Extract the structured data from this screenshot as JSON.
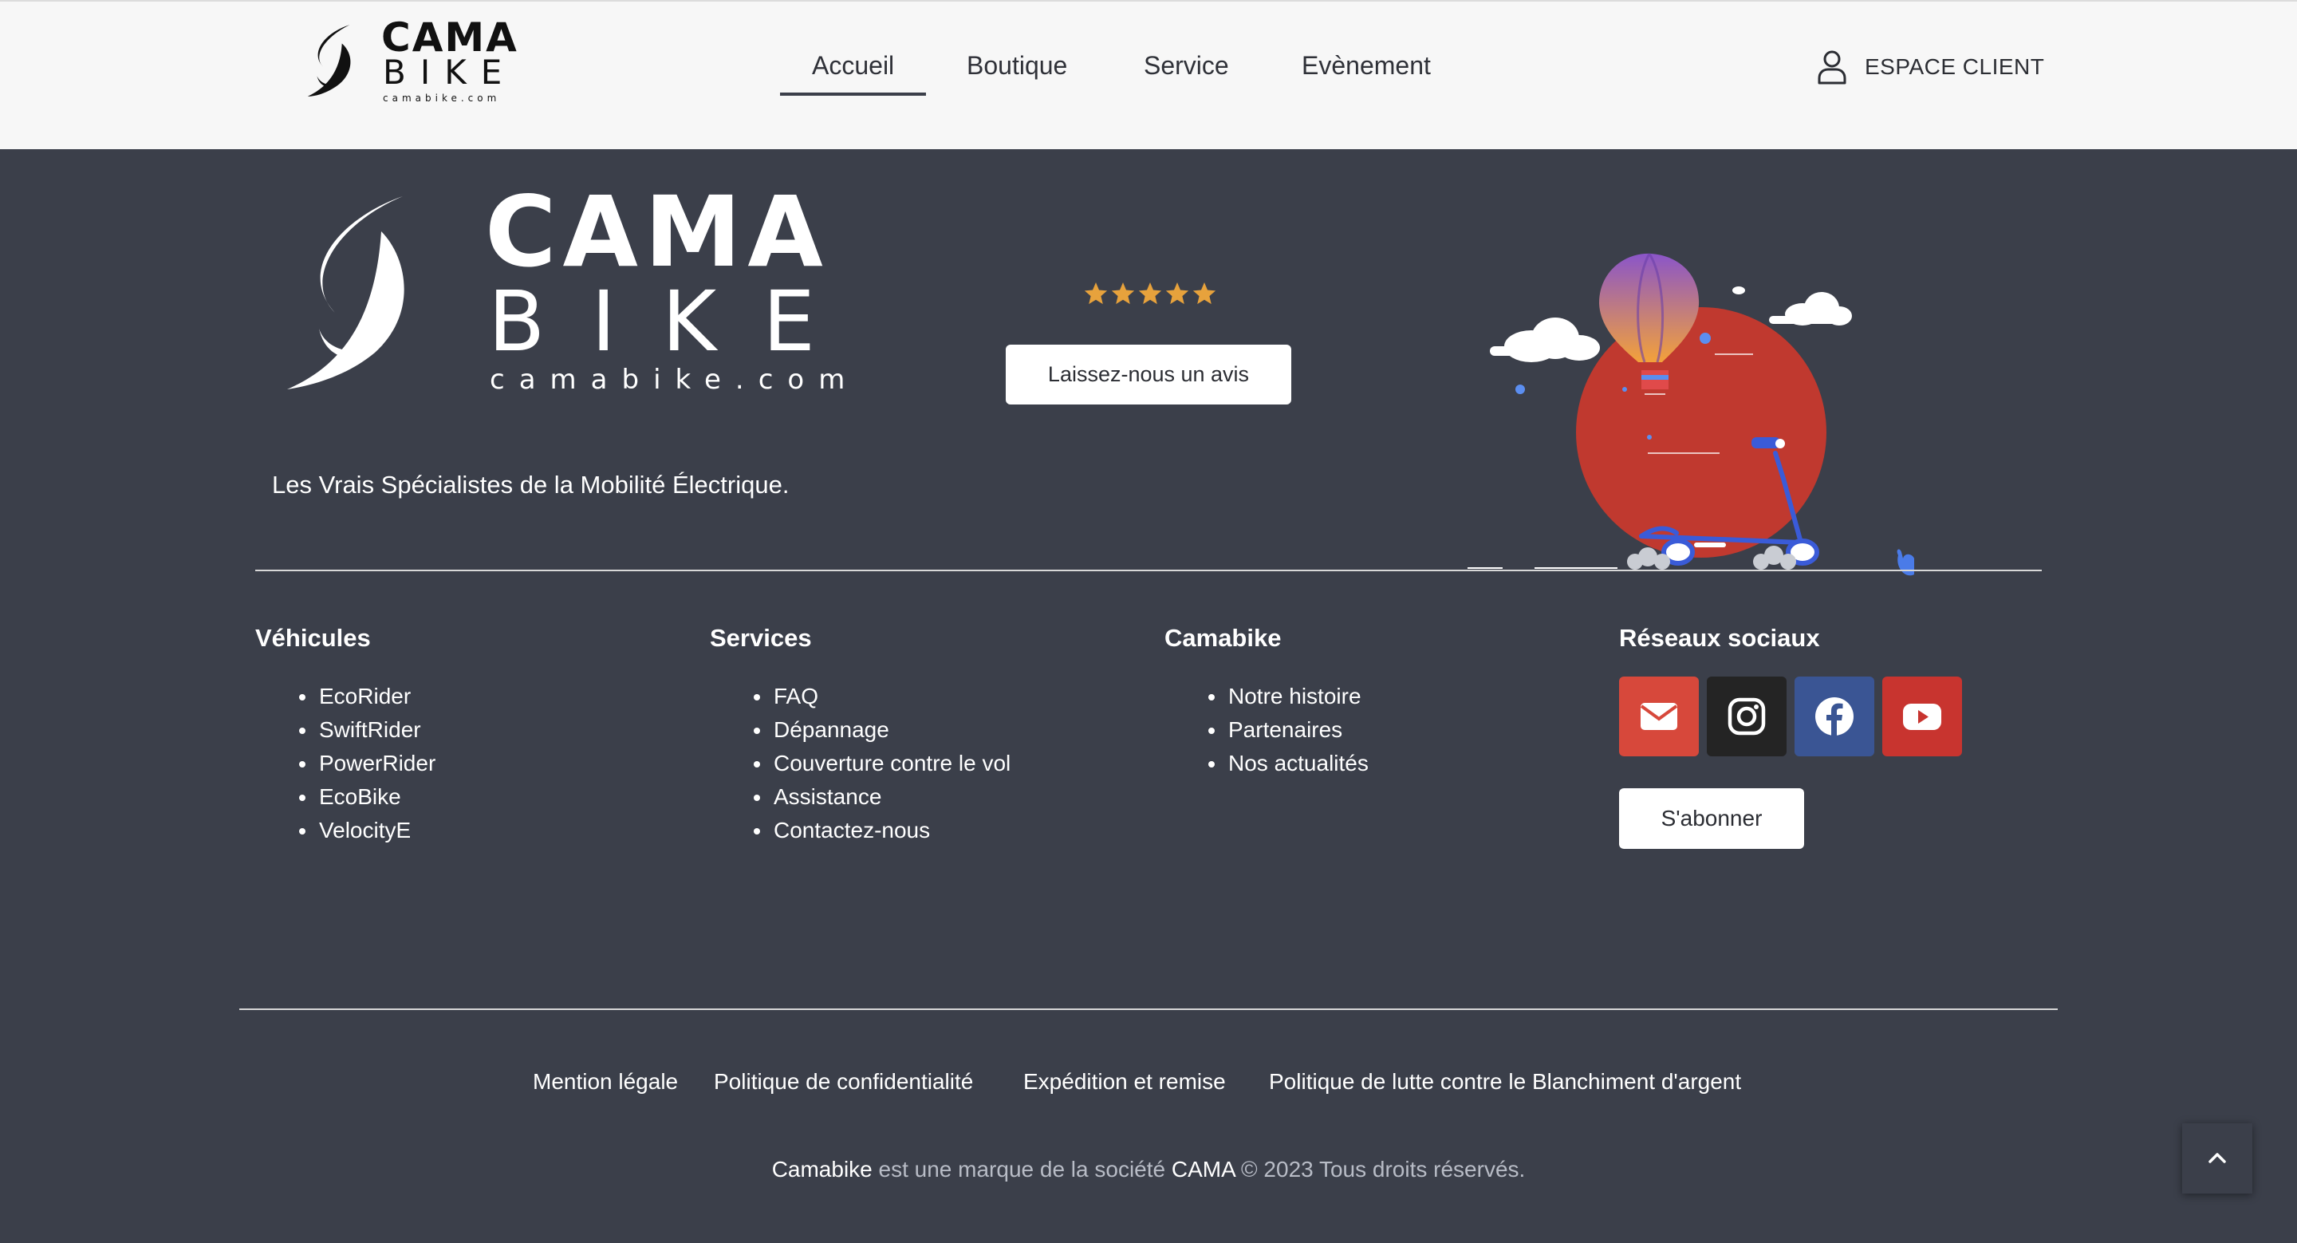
{
  "header": {
    "logo": {
      "word1": "CAMA",
      "word2": "BIKE",
      "domain": "camabike.com"
    },
    "nav": [
      {
        "label": "Accueil",
        "active": true
      },
      {
        "label": "Boutique",
        "active": false
      },
      {
        "label": "Service",
        "active": false
      },
      {
        "label": "Evènement",
        "active": false
      }
    ],
    "client_label": "ESPACE CLIENT",
    "client_icon": "user-icon"
  },
  "hero": {
    "logo": {
      "word1": "CAMA",
      "word2": "BIKE",
      "domain": "camabike.com"
    },
    "tagline": "Les Vrais Spécialistes de la Mobilité Électrique.",
    "rating": 5,
    "star_color": "#e7a23c",
    "review_button": "Laissez-nous un avis",
    "illustration": "hot-air-balloon-and-scooter-illustration"
  },
  "columns": {
    "vehicules": {
      "title": "Véhicules",
      "items": [
        "EcoRider",
        "SwiftRider",
        "PowerRider",
        "EcoBike",
        "VelocityE"
      ]
    },
    "services": {
      "title": "Services",
      "items": [
        "FAQ",
        "Dépannage",
        "Couverture contre le vol",
        "Assistance",
        "Contactez-nous"
      ]
    },
    "camabike": {
      "title": "Camabike",
      "items": [
        "Notre histoire",
        "Partenaires",
        "Nos actualités"
      ]
    },
    "reseaux": {
      "title": "Réseaux sociaux",
      "socials": [
        {
          "icon": "envelope-icon",
          "color": "#d7483b"
        },
        {
          "icon": "instagram-icon",
          "color": "#242424"
        },
        {
          "icon": "facebook-icon",
          "color": "#3a5594"
        },
        {
          "icon": "youtube-icon",
          "color": "#c8342f"
        }
      ],
      "subscribe_label": "S'abonner"
    }
  },
  "legal_links": [
    "Mention légale",
    "Politique de confidentialité",
    "Expédition et remise",
    "Politique de lutte contre le Blanchiment d'argent"
  ],
  "copyright": {
    "brand": "Camabike",
    "text1": " est une marque de la société ",
    "company": "CAMA",
    "text2": " © 2023 Tous droits réservés."
  },
  "scroll_top_icon": "chevron-up-icon",
  "colors": {
    "footer_bg": "#3b3f4a",
    "header_bg": "#f7f7f7"
  }
}
